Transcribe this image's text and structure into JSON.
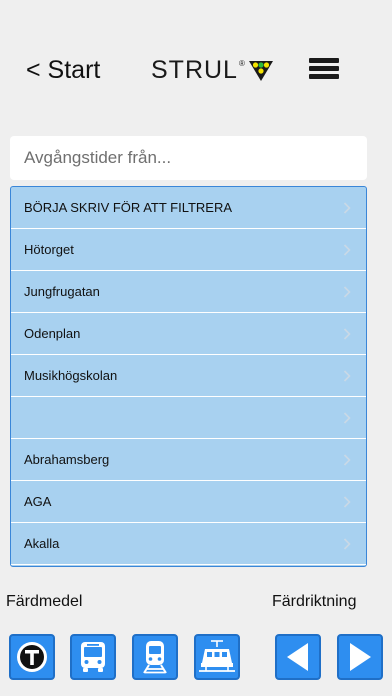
{
  "header": {
    "back_label": "< Start",
    "logo_text": "STRUL",
    "logo_reg": "®",
    "logo_mark_colors": [
      "#f4e300",
      "#2dbb3c",
      "#f4e300"
    ]
  },
  "search": {
    "placeholder": "Avgångstider från...",
    "value": ""
  },
  "list": {
    "items": [
      {
        "label": "BÖRJA SKRIV FÖR ATT FILTRERA"
      },
      {
        "label": "Hötorget"
      },
      {
        "label": "Jungfrugatan"
      },
      {
        "label": "Odenplan"
      },
      {
        "label": "Musikhögskolan"
      },
      {
        "label": ""
      },
      {
        "label": "Abrahamsberg"
      },
      {
        "label": "AGA"
      },
      {
        "label": "Akalla"
      }
    ]
  },
  "footer": {
    "mode_label": "Färdmedel",
    "direction_label": "Färdriktning",
    "modes": [
      {
        "icon": "metro-icon"
      },
      {
        "icon": "bus-icon"
      },
      {
        "icon": "train-icon"
      },
      {
        "icon": "tram-icon"
      }
    ],
    "directions": [
      {
        "icon": "arrow-left-icon"
      },
      {
        "icon": "arrow-right-icon"
      }
    ]
  },
  "colors": {
    "list_background": "#a8d1f0",
    "list_border": "#3a86d8",
    "button_blue": "#2e8ef0",
    "page_background": "#efefef"
  }
}
